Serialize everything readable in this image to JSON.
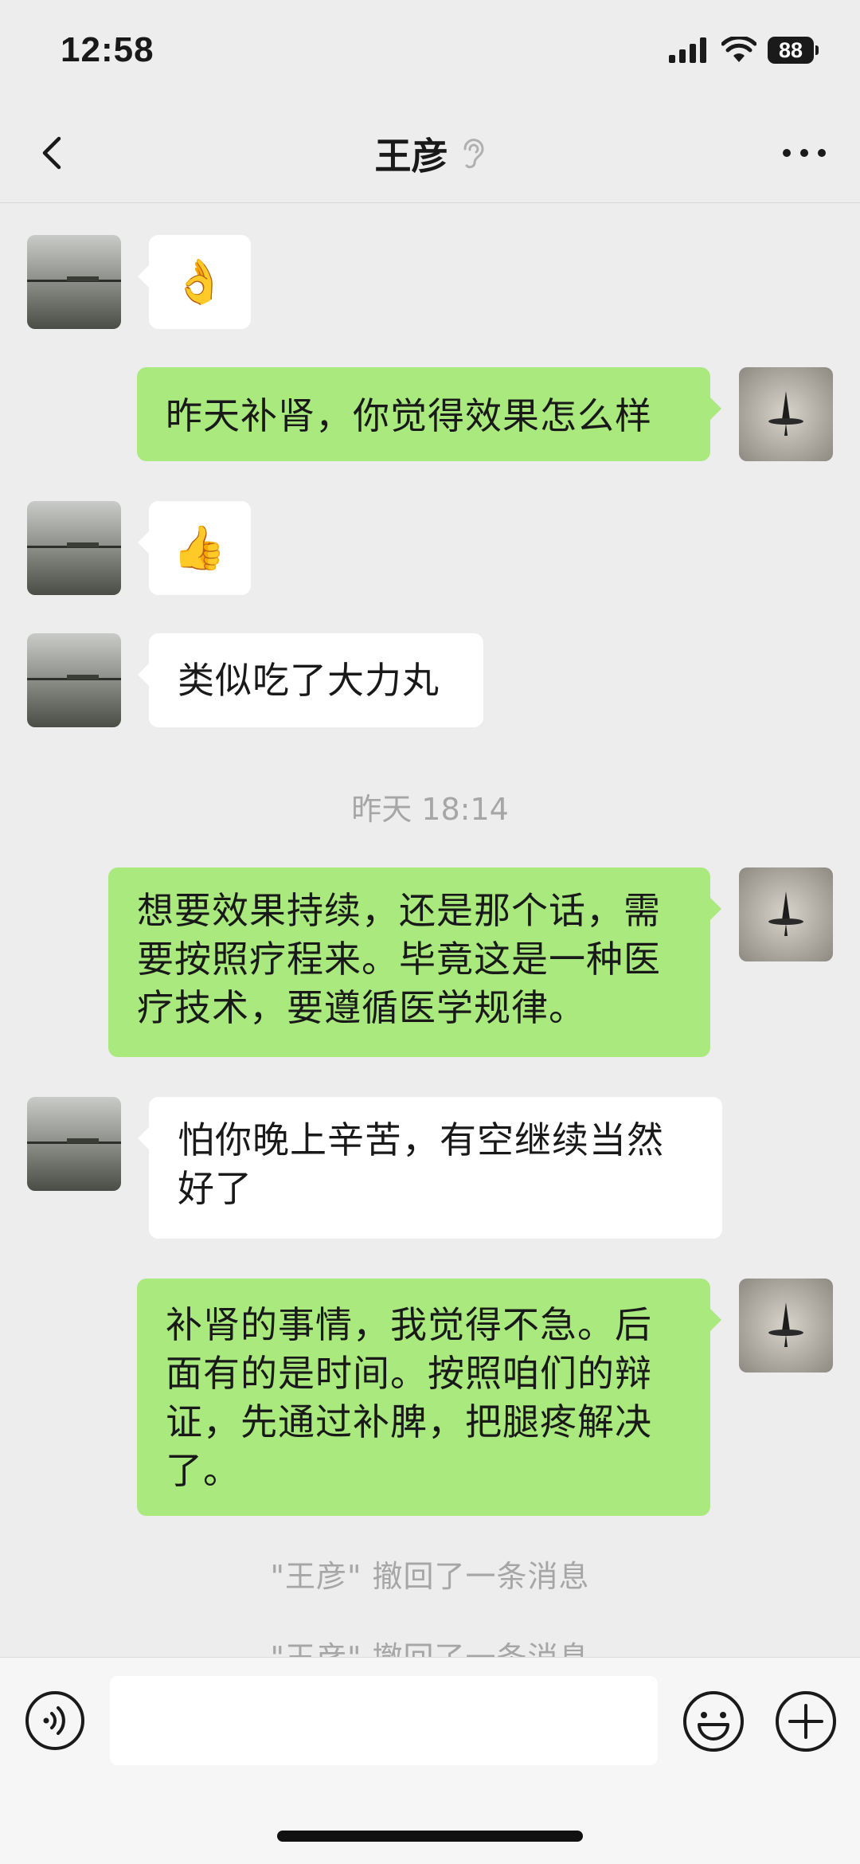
{
  "status_bar": {
    "time": "12:58",
    "battery": "88"
  },
  "header": {
    "title": "王彦"
  },
  "messages": {
    "m1": {
      "emoji": "👌"
    },
    "m2": {
      "text": "昨天补肾，你觉得效果怎么样"
    },
    "m3": {
      "emoji": "👍"
    },
    "m4": {
      "text": "类似吃了大力丸"
    },
    "ts1": {
      "text": "昨天 18:14"
    },
    "m5": {
      "text": "想要效果持续，还是那个话，需要按照疗程来。毕竟这是一种医疗技术，要遵循医学规律。"
    },
    "m6": {
      "text": "怕你晚上辛苦，有空继续当然好了"
    },
    "m7": {
      "text": "补肾的事情，我觉得不急。后面有的是时间。按照咱们的辩证，先通过补脾，把腿疼解决了。"
    },
    "sys1": {
      "text": "\"王彦\" 撤回了一条消息"
    },
    "sys2": {
      "text": "\"王彦\" 撤回了一条消息"
    }
  },
  "colors": {
    "outgoing_bubble": "#a9e97d",
    "incoming_bubble": "#ffffff",
    "background": "#ededed"
  }
}
